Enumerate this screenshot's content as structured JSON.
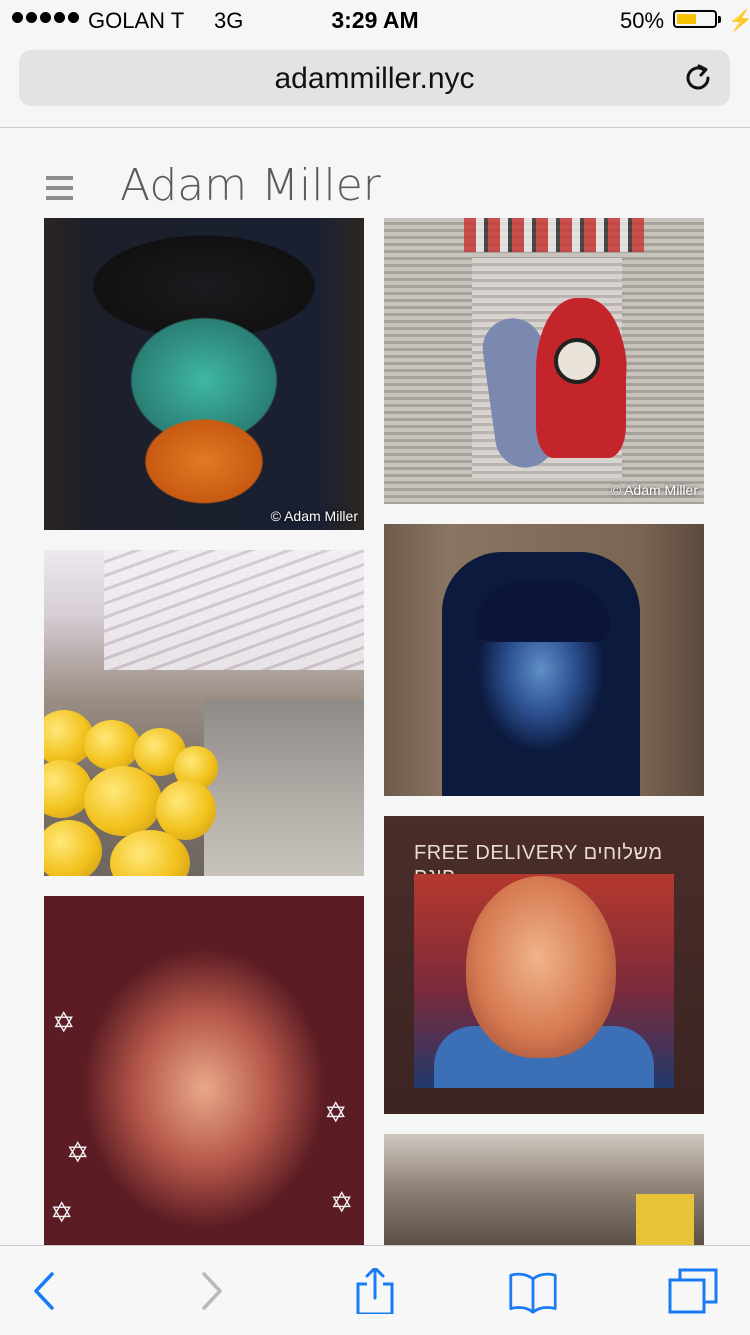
{
  "status_bar": {
    "carrier": "GOLAN T",
    "network": "3G",
    "time": "3:29 AM",
    "battery_percent": "50%",
    "battery_level": 0.5,
    "charging": true
  },
  "browser": {
    "url": "adammiller.nyc",
    "reload_icon": "reload-icon"
  },
  "site": {
    "menu_icon": "hamburger-menu-icon",
    "title": "Adam Miller"
  },
  "gallery": {
    "credit": "© Adam Miller",
    "tile5_sign": "FREE DELIVERY  משלוחים חינם"
  },
  "toolbar": {
    "icons": [
      "back-icon",
      "forward-icon",
      "share-icon",
      "bookmarks-icon",
      "tabs-icon"
    ],
    "accent_color": "#1a7cf5",
    "disabled_color": "#b8b8bd"
  }
}
